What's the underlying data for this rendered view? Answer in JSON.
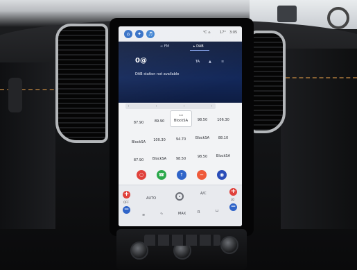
{
  "status_bar": {
    "home_icon": "home-icon",
    "nav_icon": "compass-icon",
    "media_icon": "media-icon",
    "indicators": "℃  ⌂",
    "temp": "17°",
    "time": "3:05"
  },
  "radio": {
    "tabs": [
      {
        "label": "FM",
        "icon": "radio-wave-icon"
      },
      {
        "label": "DAB",
        "icon": "dab-icon"
      }
    ],
    "station": "0@",
    "ta_label": "TA",
    "message": "DAB station not available"
  },
  "presets": [
    {
      "label": "87.90"
    },
    {
      "label": "89.90"
    },
    {
      "label": "BlockSA",
      "sub": "DAB"
    },
    {
      "label": "98.50"
    },
    {
      "label": "106.30"
    },
    {
      "label": "BlockSA"
    },
    {
      "label": "100.30"
    },
    {
      "label": "94.70"
    },
    {
      "label": "BlockSA"
    },
    {
      "label": "88.10"
    },
    {
      "label": "87.90"
    },
    {
      "label": "BlockSA"
    },
    {
      "label": "98.50"
    },
    {
      "label": "98.50"
    },
    {
      "label": "BlockSA"
    }
  ],
  "apps": [
    {
      "name": "radio-app-icon",
      "color": "#e0413b"
    },
    {
      "name": "phone-app-icon",
      "color": "#2aa84a"
    },
    {
      "name": "navigation-app-icon",
      "color": "#2f64c8"
    },
    {
      "name": "media-app-icon",
      "color": "#ef5a3a"
    },
    {
      "name": "settings-app-icon",
      "color": "#2a4db8"
    }
  ],
  "climate": {
    "left_temp": "OFF",
    "right_temp": "LO",
    "auto_label": "AUTO",
    "ac_label": "A/C",
    "max_label": "MAX",
    "rear_label": "R"
  }
}
